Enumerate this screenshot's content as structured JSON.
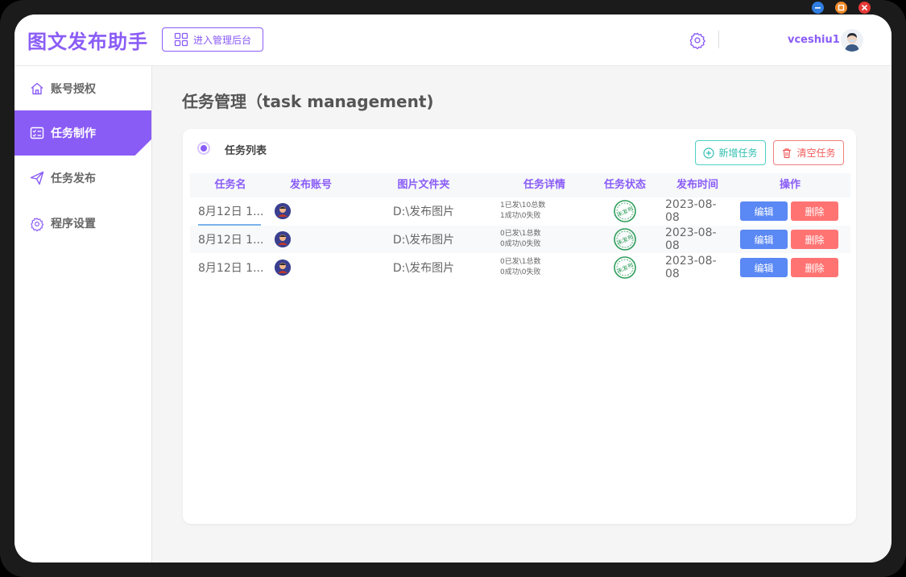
{
  "app": {
    "brand": "图文发布助手",
    "admin_button": "进入管理后台",
    "username": "vceshiu1"
  },
  "colors": {
    "accent": "#8a5cf6",
    "edit": "#5a88f4",
    "delete": "#ff7473",
    "new": "#2fbfb0",
    "clear": "#ef5b5b"
  },
  "window_controls": [
    "minimize-icon",
    "maximize-icon",
    "close-icon"
  ],
  "sidebar": {
    "items": [
      {
        "label": "账号授权",
        "icon": "home-icon",
        "active": false
      },
      {
        "label": "任务制作",
        "icon": "checklist-icon",
        "active": true
      },
      {
        "label": "任务发布",
        "icon": "send-icon",
        "active": false
      },
      {
        "label": "程序设置",
        "icon": "gear-icon",
        "active": false
      }
    ]
  },
  "page": {
    "title": "任务管理（task management)"
  },
  "card": {
    "title": "任务列表",
    "new_button": "新增任务",
    "clear_button": "清空任务"
  },
  "table": {
    "headers": [
      "任务名",
      "发布账号",
      "图片文件夹",
      "任务详情",
      "任务状态",
      "发布时间",
      "操作"
    ],
    "rows": [
      {
        "name": "8月12日 1...",
        "folder": "D:\\发布图片",
        "detail1": "1已发\\10总数",
        "detail2": "1成功\\0失败",
        "status": "未发布",
        "date": "2023-08-08",
        "edit": "编辑",
        "delete": "删除"
      },
      {
        "name": "8月12日 1...",
        "folder": "D:\\发布图片",
        "detail1": "0已发\\1总数",
        "detail2": "0成功\\0失败",
        "status": "未发布",
        "date": "2023-08-08",
        "edit": "编辑",
        "delete": "删除"
      },
      {
        "name": "8月12日 1...",
        "folder": "D:\\发布图片",
        "detail1": "0已发\\1总数",
        "detail2": "0成功\\0失败",
        "status": "未发布",
        "date": "2023-08-08",
        "edit": "编辑",
        "delete": "删除"
      }
    ]
  }
}
